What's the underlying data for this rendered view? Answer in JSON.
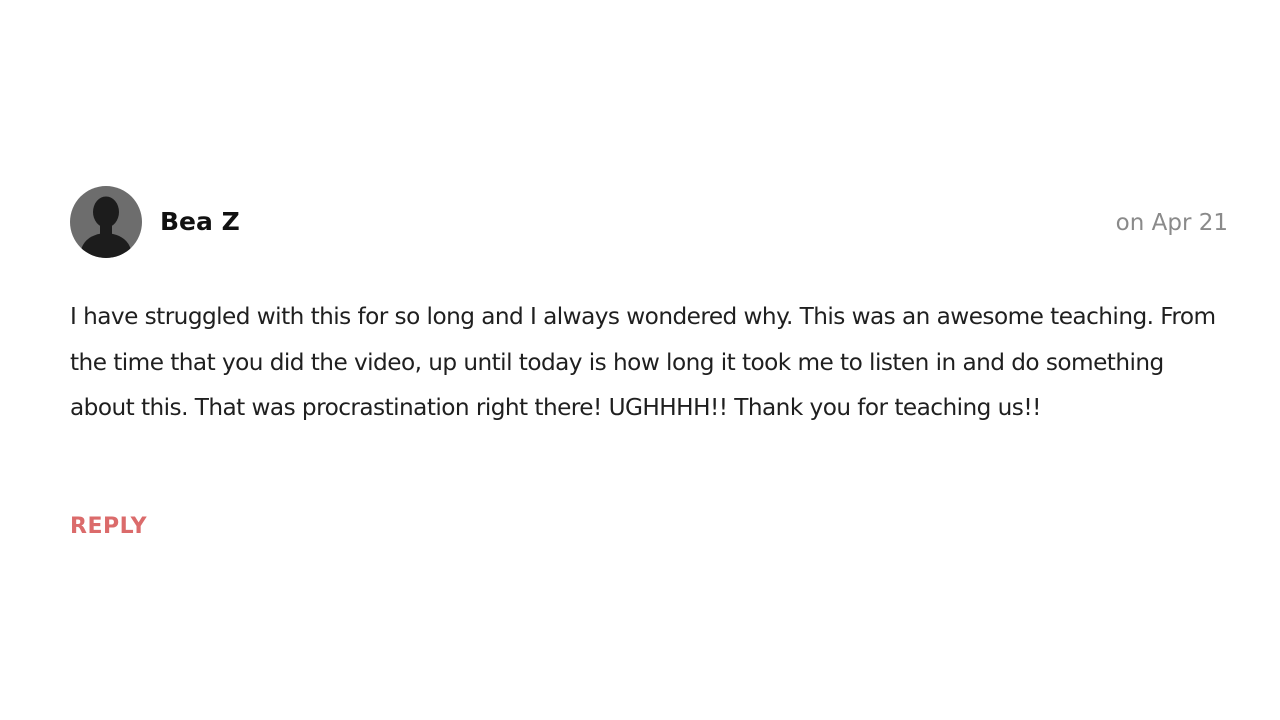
{
  "comment": {
    "author": "Bea Z",
    "date": "on Apr 21",
    "body": "I have struggled with this for so long and I always wondered why. This was an awesome teaching. From the time that you did the video, up until today is how long it took me to listen in and do something about this. That was procrastination right there! UGHHHH!! Thank you for teaching us!!",
    "reply_label": "REPLY"
  },
  "colors": {
    "avatar_bg": "#6d6d6d",
    "avatar_silhouette": "#1c1c1c",
    "date_text": "#8a8a8a",
    "reply_accent": "#db6b6b",
    "body_text": "#1f1f1f"
  },
  "icons": {
    "avatar": "user-silhouette-icon"
  }
}
